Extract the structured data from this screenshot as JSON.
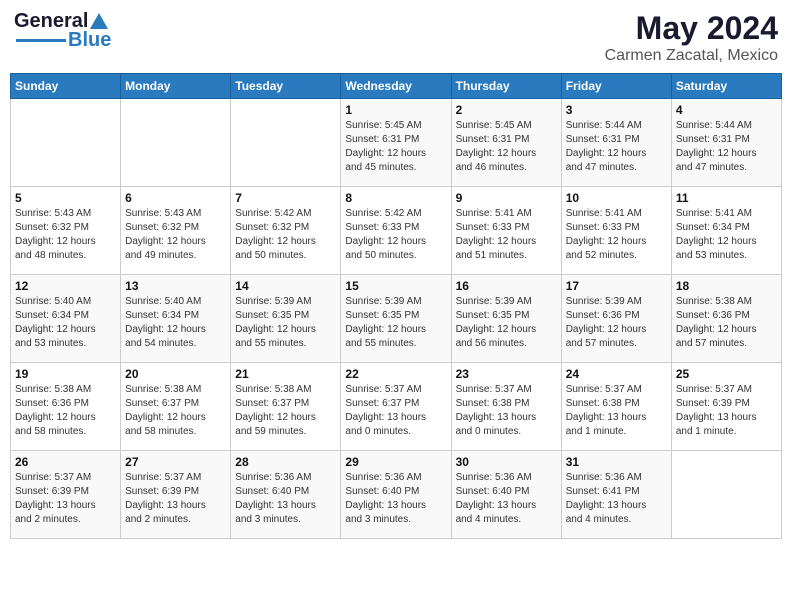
{
  "header": {
    "logo_general": "General",
    "logo_blue": "Blue",
    "title": "May 2024",
    "subtitle": "Carmen Zacatal, Mexico"
  },
  "days_of_week": [
    "Sunday",
    "Monday",
    "Tuesday",
    "Wednesday",
    "Thursday",
    "Friday",
    "Saturday"
  ],
  "weeks": [
    [
      {
        "day": "",
        "info": ""
      },
      {
        "day": "",
        "info": ""
      },
      {
        "day": "",
        "info": ""
      },
      {
        "day": "1",
        "info": "Sunrise: 5:45 AM\nSunset: 6:31 PM\nDaylight: 12 hours\nand 45 minutes."
      },
      {
        "day": "2",
        "info": "Sunrise: 5:45 AM\nSunset: 6:31 PM\nDaylight: 12 hours\nand 46 minutes."
      },
      {
        "day": "3",
        "info": "Sunrise: 5:44 AM\nSunset: 6:31 PM\nDaylight: 12 hours\nand 47 minutes."
      },
      {
        "day": "4",
        "info": "Sunrise: 5:44 AM\nSunset: 6:31 PM\nDaylight: 12 hours\nand 47 minutes."
      }
    ],
    [
      {
        "day": "5",
        "info": "Sunrise: 5:43 AM\nSunset: 6:32 PM\nDaylight: 12 hours\nand 48 minutes."
      },
      {
        "day": "6",
        "info": "Sunrise: 5:43 AM\nSunset: 6:32 PM\nDaylight: 12 hours\nand 49 minutes."
      },
      {
        "day": "7",
        "info": "Sunrise: 5:42 AM\nSunset: 6:32 PM\nDaylight: 12 hours\nand 50 minutes."
      },
      {
        "day": "8",
        "info": "Sunrise: 5:42 AM\nSunset: 6:33 PM\nDaylight: 12 hours\nand 50 minutes."
      },
      {
        "day": "9",
        "info": "Sunrise: 5:41 AM\nSunset: 6:33 PM\nDaylight: 12 hours\nand 51 minutes."
      },
      {
        "day": "10",
        "info": "Sunrise: 5:41 AM\nSunset: 6:33 PM\nDaylight: 12 hours\nand 52 minutes."
      },
      {
        "day": "11",
        "info": "Sunrise: 5:41 AM\nSunset: 6:34 PM\nDaylight: 12 hours\nand 53 minutes."
      }
    ],
    [
      {
        "day": "12",
        "info": "Sunrise: 5:40 AM\nSunset: 6:34 PM\nDaylight: 12 hours\nand 53 minutes."
      },
      {
        "day": "13",
        "info": "Sunrise: 5:40 AM\nSunset: 6:34 PM\nDaylight: 12 hours\nand 54 minutes."
      },
      {
        "day": "14",
        "info": "Sunrise: 5:39 AM\nSunset: 6:35 PM\nDaylight: 12 hours\nand 55 minutes."
      },
      {
        "day": "15",
        "info": "Sunrise: 5:39 AM\nSunset: 6:35 PM\nDaylight: 12 hours\nand 55 minutes."
      },
      {
        "day": "16",
        "info": "Sunrise: 5:39 AM\nSunset: 6:35 PM\nDaylight: 12 hours\nand 56 minutes."
      },
      {
        "day": "17",
        "info": "Sunrise: 5:39 AM\nSunset: 6:36 PM\nDaylight: 12 hours\nand 57 minutes."
      },
      {
        "day": "18",
        "info": "Sunrise: 5:38 AM\nSunset: 6:36 PM\nDaylight: 12 hours\nand 57 minutes."
      }
    ],
    [
      {
        "day": "19",
        "info": "Sunrise: 5:38 AM\nSunset: 6:36 PM\nDaylight: 12 hours\nand 58 minutes."
      },
      {
        "day": "20",
        "info": "Sunrise: 5:38 AM\nSunset: 6:37 PM\nDaylight: 12 hours\nand 58 minutes."
      },
      {
        "day": "21",
        "info": "Sunrise: 5:38 AM\nSunset: 6:37 PM\nDaylight: 12 hours\nand 59 minutes."
      },
      {
        "day": "22",
        "info": "Sunrise: 5:37 AM\nSunset: 6:37 PM\nDaylight: 13 hours\nand 0 minutes."
      },
      {
        "day": "23",
        "info": "Sunrise: 5:37 AM\nSunset: 6:38 PM\nDaylight: 13 hours\nand 0 minutes."
      },
      {
        "day": "24",
        "info": "Sunrise: 5:37 AM\nSunset: 6:38 PM\nDaylight: 13 hours\nand 1 minute."
      },
      {
        "day": "25",
        "info": "Sunrise: 5:37 AM\nSunset: 6:39 PM\nDaylight: 13 hours\nand 1 minute."
      }
    ],
    [
      {
        "day": "26",
        "info": "Sunrise: 5:37 AM\nSunset: 6:39 PM\nDaylight: 13 hours\nand 2 minutes."
      },
      {
        "day": "27",
        "info": "Sunrise: 5:37 AM\nSunset: 6:39 PM\nDaylight: 13 hours\nand 2 minutes."
      },
      {
        "day": "28",
        "info": "Sunrise: 5:36 AM\nSunset: 6:40 PM\nDaylight: 13 hours\nand 3 minutes."
      },
      {
        "day": "29",
        "info": "Sunrise: 5:36 AM\nSunset: 6:40 PM\nDaylight: 13 hours\nand 3 minutes."
      },
      {
        "day": "30",
        "info": "Sunrise: 5:36 AM\nSunset: 6:40 PM\nDaylight: 13 hours\nand 4 minutes."
      },
      {
        "day": "31",
        "info": "Sunrise: 5:36 AM\nSunset: 6:41 PM\nDaylight: 13 hours\nand 4 minutes."
      },
      {
        "day": "",
        "info": ""
      }
    ]
  ]
}
